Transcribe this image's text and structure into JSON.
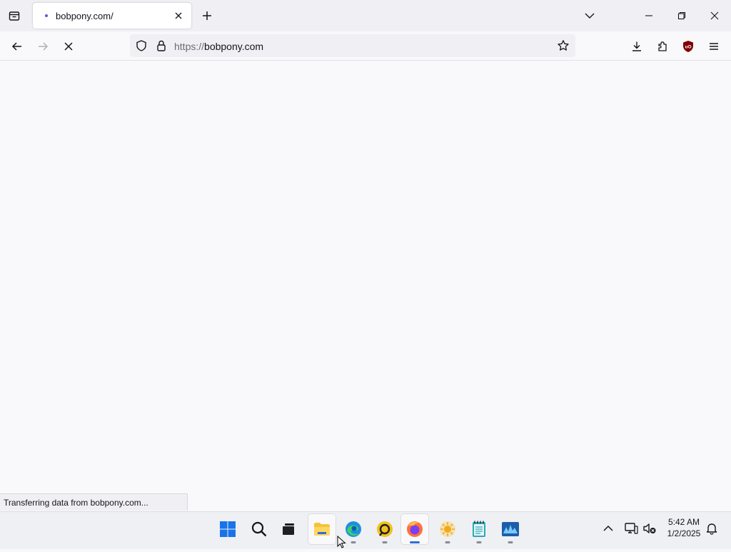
{
  "browser": {
    "tab": {
      "title": "bobpony.com/"
    },
    "url": {
      "scheme": "https://",
      "host": "bobpony.com"
    },
    "status_text": "Transferring data from bobpony.com..."
  },
  "taskbar": {
    "apps": [
      "start",
      "search",
      "task-view",
      "file-explorer",
      "edge",
      "app-yellow",
      "firefox",
      "app-sun",
      "notepad",
      "task-manager"
    ],
    "clock": {
      "time": "5:42 AM",
      "date": "1/2/2025"
    }
  },
  "colors": {
    "accent": "#2f6fd8",
    "ublock": "#800000",
    "file_explorer": "#f5c33b",
    "firefox": "#ff7139"
  }
}
